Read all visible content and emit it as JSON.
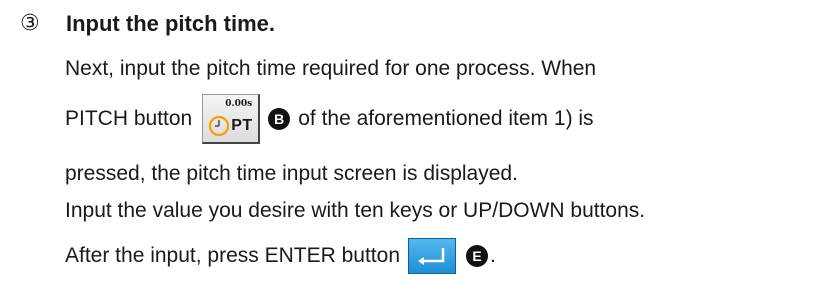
{
  "step": {
    "number": "③",
    "title": "Input the pitch time."
  },
  "paragraph": {
    "line1": "Next, input the pitch time required for one process. When",
    "line2_before": "PITCH button",
    "line2_after": "of the aforementioned item 1) is",
    "line3": "pressed, the pitch time input screen is displayed.",
    "line4": "Input the value you desire with ten keys or UP/DOWN buttons.",
    "line5_before": "After the input, press ENTER button",
    "line5_after": "."
  },
  "pitch_button": {
    "value": "0.00s",
    "label": "PT",
    "icon": "clock-icon",
    "icon_color": "#f2a000"
  },
  "badges": {
    "pitch": "B",
    "enter": "E"
  },
  "enter_button": {
    "icon": "enter-return-icon",
    "color": "#2a9ee0"
  }
}
